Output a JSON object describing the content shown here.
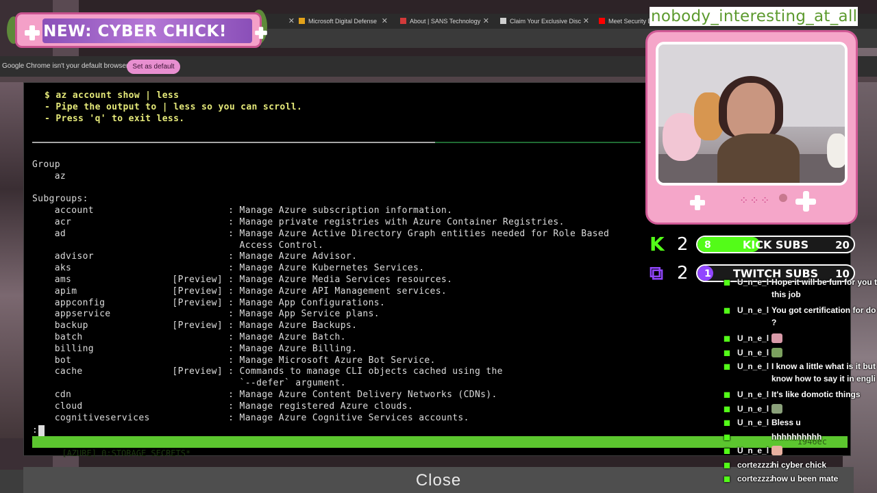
{
  "browser": {
    "tabs": [
      {
        "label": "Microsoft Digital Defense",
        "fav_color": "#e3a21a"
      },
      {
        "label": "About | SANS Technology",
        "fav_color": "#d23a3a"
      },
      {
        "label": "Claim Your Exclusive Disc",
        "fav_color": "#cfcfcf"
      },
      {
        "label": "Meet Security E",
        "fav_color": "#ff0000"
      }
    ],
    "infobar_text": "Google Chrome isn't your default browser",
    "set_default_label": "Set as default"
  },
  "terminal": {
    "hint_lines": [
      "$ az account show | less",
      "- Pipe the output to | less so you can scroll.",
      "- Press 'q' to exit less."
    ],
    "lines": [
      "Group",
      "    az",
      "",
      "Subgroups:",
      "    account                        : Manage Azure subscription information.",
      "    acr                            : Manage private registries with Azure Container Registries.",
      "    ad                             : Manage Azure Active Directory Graph entities needed for Role Based",
      "                                     Access Control.",
      "    advisor                        : Manage Azure Advisor.",
      "    aks                            : Manage Azure Kubernetes Services.",
      "    ams                  [Preview] : Manage Azure Media Services resources.",
      "    apim                 [Preview] : Manage Azure API Management services.",
      "    appconfig            [Preview] : Manage App Configurations.",
      "    appservice                     : Manage App Service plans.",
      "    backup               [Preview] : Manage Azure Backups.",
      "    batch                          : Manage Azure Batch.",
      "    billing                        : Manage Azure Billing.",
      "    bot                            : Manage Microsoft Azure Bot Service.",
      "    cache                [Preview] : Commands to manage CLI objects cached using the",
      "                                     `--defer` argument.",
      "    cdn                            : Manage Azure Content Delivery Networks (CDNs).",
      "    cloud                          : Manage registered Azure clouds.",
      "    cognitiveservices              : Manage Azure Cognitive Services accounts."
    ],
    "prompt": ":",
    "status_left": "[AZURE] 0:STORAGE SECRETS*",
    "status_right": "\"1946ec"
  },
  "close_label": "Close",
  "overlay": {
    "banner_title": "NEW: CYBER CHICK!",
    "username": "nobody_interesting_at_all",
    "goals": [
      {
        "platform": "kick",
        "icon": "K",
        "icon_color": "#53fc18",
        "count": "2",
        "current": "8",
        "label": "KICK SUBS",
        "max": "20",
        "progress": 0.4,
        "fill": "#53fc18"
      },
      {
        "platform": "twitch",
        "icon": "⧉",
        "icon_color": "#9146ff",
        "count": "2",
        "current": "1",
        "label": "TWITCH SUBS",
        "max": "10",
        "progress": 0.1,
        "fill": "#9146ff"
      }
    ],
    "chat": [
      {
        "user": "U_n_e_l",
        "text": "Hope it will be fun for you t",
        "text2": "this job"
      },
      {
        "user": "U_n_e_l",
        "text": "You got certification for do",
        "text2": "?"
      },
      {
        "user": "U_n_e_l",
        "text": ""
      },
      {
        "user": "U_n_e_l",
        "text": ""
      },
      {
        "user": "U_n_e_l",
        "text": "I know a little what is it but",
        "text2": "know how to say it in engli"
      },
      {
        "user": "U_n_e_l",
        "text": "It's like domotic things"
      },
      {
        "user": "U_n_e_l",
        "text": ""
      },
      {
        "user": "U_n_e_l",
        "text": "Bless u"
      },
      {
        "user": "",
        "text": "hhhhhhhhhh"
      },
      {
        "user": "U_n_e_l",
        "text": ""
      },
      {
        "user": "cortezzzz",
        "text": "hi cyber chick"
      },
      {
        "user": "cortezzzz",
        "text": "how u been mate"
      }
    ]
  }
}
